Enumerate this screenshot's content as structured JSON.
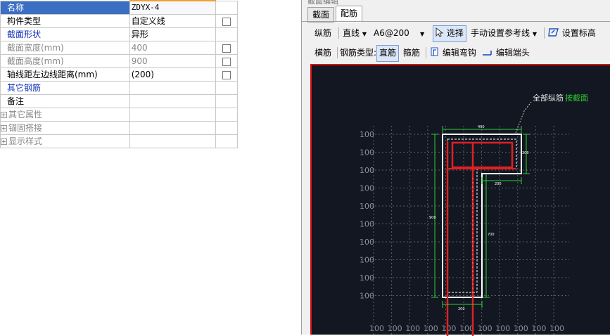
{
  "props": {
    "rows": [
      {
        "label": "名称",
        "value": "ZDYX-4"
      },
      {
        "label": "构件类型",
        "value": "自定义线"
      },
      {
        "label": "截面形状",
        "value": "异形"
      },
      {
        "label": "截面宽度(mm)",
        "value": "400"
      },
      {
        "label": "截面高度(mm)",
        "value": "900"
      },
      {
        "label": "轴线距左边线距离(mm)",
        "value": "(200)"
      },
      {
        "label": "其它钢筋",
        "value": ""
      },
      {
        "label": "备注",
        "value": ""
      },
      {
        "label": "其它属性",
        "value": ""
      },
      {
        "label": "锚固搭接",
        "value": ""
      },
      {
        "label": "显示样式",
        "value": ""
      }
    ]
  },
  "panel": {
    "title": "截面编辑",
    "tabs": [
      "截面",
      "配筋"
    ]
  },
  "toolbar1": {
    "longitudinal": "纵筋",
    "mode": "直线",
    "spec": "A6@200",
    "select": "选择",
    "manual_ref": "手动设置参考线",
    "set_elev": "设置标高"
  },
  "toolbar2": {
    "transverse": "横筋",
    "rebar_type": "钢筋类型:",
    "straight": "直筋",
    "stirrup": "箍筋",
    "edit_hook": "编辑弯钩",
    "edit_end": "编辑端头"
  },
  "canvas": {
    "annotation_all": "全部纵筋",
    "annotation_by": "按截面",
    "grid_label": "100",
    "dim_top": "400",
    "dim_right_top": "200",
    "dim_notch": "200",
    "dim_left": "900",
    "dim_right": "700",
    "dim_bottom": "200",
    "colors": {
      "bg": "#121722",
      "grid": "#5a5f6a",
      "outline": "#ffffff",
      "rebar": "#e02020",
      "dim": "#2fd12f"
    }
  }
}
